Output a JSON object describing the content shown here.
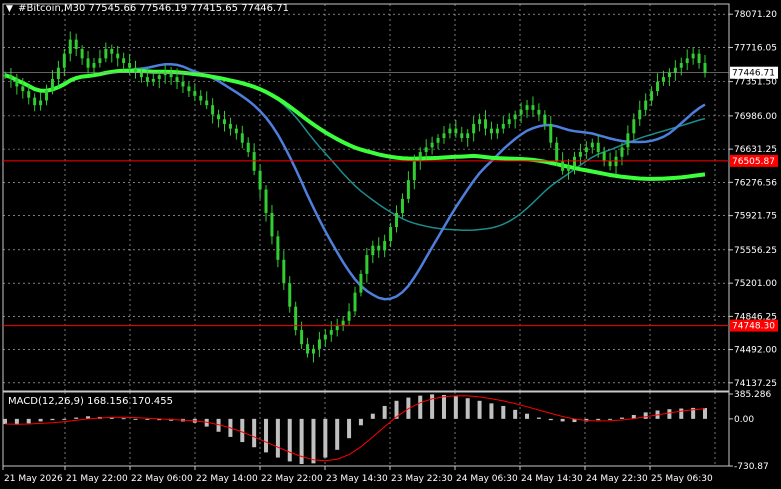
{
  "header": {
    "symbol_timeframe": "#Bitcoin,M30",
    "open": "77545.66",
    "high": "77546.19",
    "low": "77415.65",
    "close": "77446.71",
    "arrow_icon": "triangle-down-icon"
  },
  "colors": {
    "background": "#000000",
    "grid": "#c8c8c8",
    "candle_up": "#32cd32",
    "candle_down": "#32cd32",
    "ma_fast": "#1e8c8c",
    "ma_mid": "#4f7fdc",
    "ma_slow": "#3cff3c",
    "hline": "#ff0000",
    "macd_hist": "#c0c0c0",
    "macd_signal": "#ff0000"
  },
  "price_axis": {
    "ticks": [
      "78071.20",
      "77716.05",
      "77351.50",
      "76986.00",
      "76631.25",
      "76276.56",
      "75921.75",
      "75556.25",
      "75201.00",
      "74846.25",
      "74492.00",
      "74137.25"
    ],
    "current_price_label": "77446.71",
    "hline_upper_label": "76505.87",
    "hline_lower_label": "74748.30"
  },
  "macd": {
    "label": "MACD(12,26,9) 168.156 170.455",
    "ticks": [
      "385.286",
      "0.00",
      "-730.87"
    ]
  },
  "time_axis": {
    "labels": [
      "21 May 2026",
      "21 May 22:00",
      "22 May 06:00",
      "22 May 14:00",
      "22 May 22:00",
      "23 May 14:30",
      "23 May 22:30",
      "24 May 06:30",
      "24 May 14:30",
      "24 May 22:30",
      "25 May 06:30"
    ]
  },
  "chart_data": {
    "type": "candlestick",
    "symbol": "#Bitcoin",
    "timeframe": "M30",
    "horizontal_lines": [
      76505.87,
      74748.3
    ],
    "close_series": [
      77420,
      77380,
      77300,
      77250,
      77180,
      77100,
      77150,
      77260,
      77380,
      77500,
      77650,
      77800,
      77700,
      77600,
      77500,
      77550,
      77600,
      77700,
      77650,
      77600,
      77550,
      77500,
      77450,
      77400,
      77350,
      77380,
      77420,
      77450,
      77400,
      77350,
      77300,
      77250,
      77200,
      77150,
      77100,
      77000,
      76950,
      76900,
      76850,
      76800,
      76700,
      76600,
      76400,
      76200,
      75950,
      75700,
      75450,
      75200,
      74950,
      74700,
      74550,
      74450,
      74500,
      74600,
      74650,
      74700,
      74750,
      74800,
      74900,
      75100,
      75300,
      75500,
      75600,
      75550,
      75650,
      75800,
      75950,
      76100,
      76300,
      76500,
      76600,
      76650,
      76700,
      76750,
      76800,
      76850,
      76800,
      76750,
      76800,
      76900,
      76950,
      76850,
      76800,
      76850,
      76900,
      76950,
      77000,
      77050,
      77100,
      77050,
      77000,
      76900,
      76700,
      76500,
      76400,
      76450,
      76550,
      76600,
      76650,
      76700,
      76600,
      76500,
      76450,
      76550,
      76650,
      76800,
      76950,
      77050,
      77150,
      77250,
      77350,
      77400,
      77450,
      77500,
      77550,
      77600,
      77650,
      77550,
      77450
    ],
    "macd_hist_scale": [
      -80,
      -90,
      -70,
      -40,
      -20,
      0,
      20,
      40,
      30,
      20,
      10,
      0,
      -10,
      -20,
      -30,
      -40,
      -60,
      -120,
      -200,
      -280,
      -360,
      -440,
      -520,
      -600,
      -660,
      -700,
      -690,
      -600,
      -480,
      -300,
      -100,
      80,
      200,
      280,
      330,
      360,
      380,
      370,
      350,
      320,
      280,
      240,
      200,
      140,
      80,
      20,
      -20,
      -40,
      -50,
      -40,
      -20,
      0,
      20,
      60,
      100,
      130,
      150,
      160,
      170,
      168
    ]
  }
}
